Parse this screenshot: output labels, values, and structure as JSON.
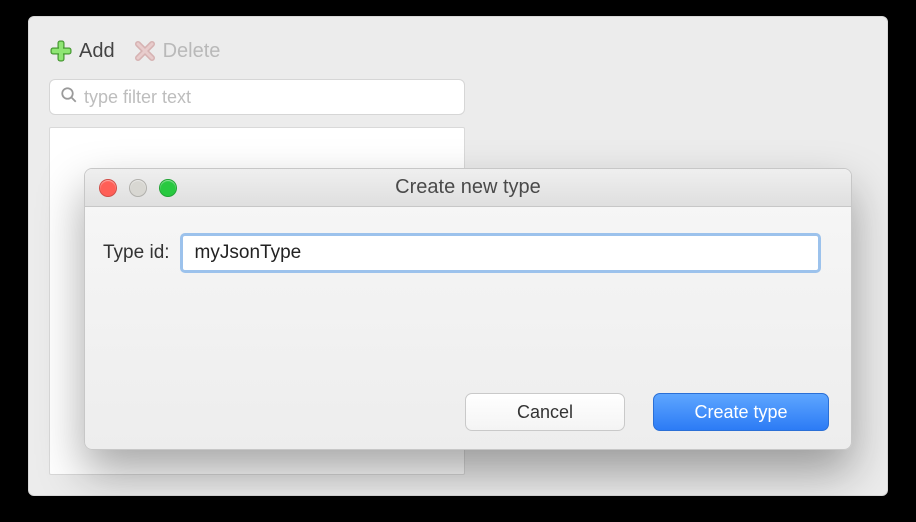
{
  "toolbar": {
    "add_label": "Add",
    "delete_label": "Delete"
  },
  "search": {
    "placeholder": "type filter text",
    "value": ""
  },
  "modal": {
    "title": "Create new type",
    "field_label": "Type id:",
    "field_value": "myJsonType",
    "cancel_label": "Cancel",
    "submit_label": "Create type"
  },
  "colors": {
    "accent": "#2c7bf5",
    "focus_ring": "#9cc2ec",
    "add_icon": "#4fb13a",
    "delete_icon": "#d0a6a6"
  }
}
